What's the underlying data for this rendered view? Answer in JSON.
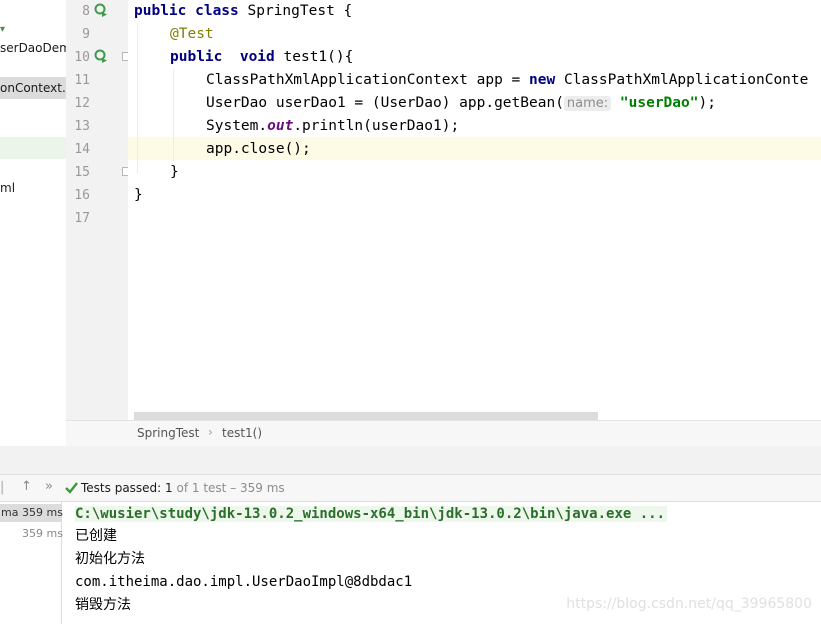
{
  "project_tree": {
    "items": [
      "serDaoDem",
      "onContext.x",
      "ml"
    ]
  },
  "editor": {
    "line_numbers": [
      "8",
      "9",
      "10",
      "11",
      "12",
      "13",
      "14",
      "15",
      "16",
      "17"
    ],
    "lines": [
      {
        "parts": [
          [
            "kw",
            "public class "
          ],
          [
            "",
            "SpringTest {"
          ]
        ]
      },
      {
        "parts": [
          [
            "",
            ""
          ],
          [
            "ann",
            "@Test"
          ]
        ]
      },
      {
        "parts": [
          [
            "kw",
            "public  void "
          ],
          [
            "",
            "test1(){"
          ]
        ]
      },
      {
        "parts": [
          [
            "",
            "ClassPathXmlApplicationContext app = "
          ],
          [
            "kw",
            "new "
          ],
          [
            "",
            "ClassPathXmlApplicationConte"
          ]
        ]
      },
      {
        "parts": [
          [
            "",
            "UserDao userDao1 = (UserDao) app.getBean("
          ],
          [
            "hint",
            "name:"
          ],
          [
            "",
            " "
          ],
          [
            "str",
            "\"userDao\""
          ],
          [
            "",
            ");"
          ]
        ]
      },
      {
        "parts": [
          [
            "",
            "System."
          ],
          [
            "fld",
            "out"
          ],
          [
            "",
            ".println(userDao1);"
          ]
        ]
      },
      {
        "parts": [
          [
            "",
            "app.close();"
          ]
        ]
      },
      {
        "parts": [
          [
            "",
            "}"
          ]
        ]
      },
      {
        "parts": [
          [
            "",
            "}"
          ]
        ]
      },
      {
        "parts": []
      }
    ]
  },
  "breadcrumb": {
    "class_name": "SpringTest",
    "method_name": "test1()"
  },
  "run_toolbar": {
    "status_prefix": "Tests passed:",
    "passed_count": "1",
    "status_suffix": "of 1 test – 359 ms"
  },
  "run_tree": {
    "row1_name": "ma",
    "row1_time": "359 ms",
    "row2_time": "359 ms"
  },
  "console": {
    "lines": [
      "C:\\wusier\\study\\jdk-13.0.2_windows-x64_bin\\jdk-13.0.2\\bin\\java.exe ...",
      "已创建",
      "初始化方法",
      "com.itheima.dao.impl.UserDaoImpl@8dbdac1",
      "销毁方法"
    ]
  },
  "watermark": "https://blog.csdn.net/qq_39965800",
  "colors": {
    "keyword": "#000080",
    "annotation": "#808000",
    "string": "#008000",
    "field": "#660e7a",
    "caret_line": "#fdfbe6",
    "pass_green": "#3a9a3a"
  },
  "icons": [
    "run-test-icon",
    "fold-icon",
    "arrow-up-icon",
    "double-chevron-icon",
    "check-icon"
  ]
}
